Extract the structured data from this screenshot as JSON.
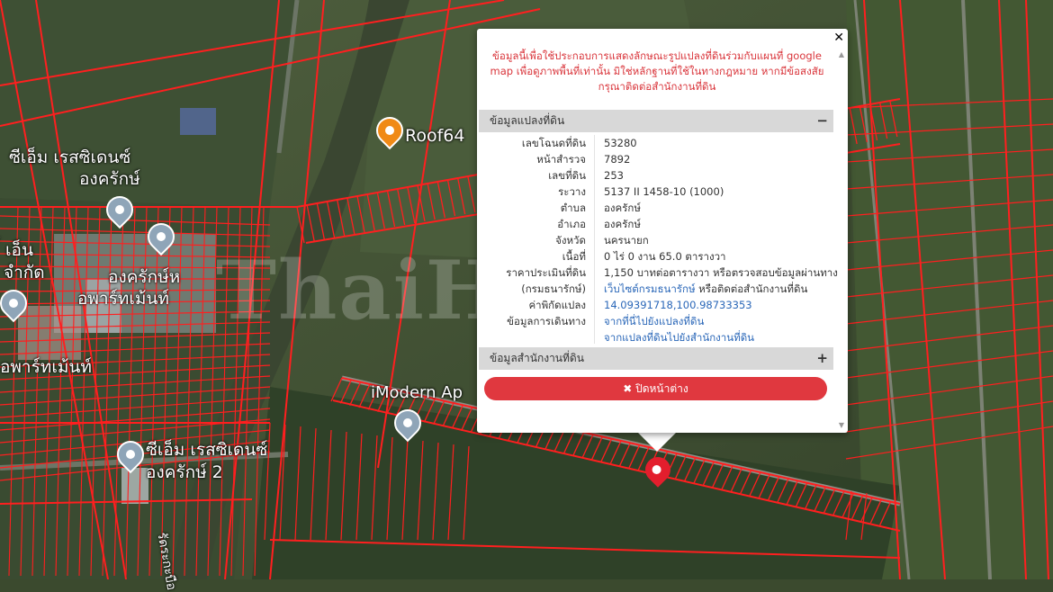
{
  "map": {
    "labels": {
      "cm_residence": "ซีเอ็ม เรสซิเดนซ์",
      "ongkharak": "องครักษ์",
      "ongkharak_apartment_1": "องครักษ์ห",
      "ongkharak_apartment_2": "อพาร์ทเม้นท์",
      "apartment_partial": "อพาร์ทเม้นท์",
      "en_partial": "์ เอ็น",
      "chamkat_partial": "จำกัด",
      "roof64": "Roof64",
      "imodern": "iModern Ap",
      "cm_residence_2_line1": "ซีเอ็ม เรสซิเดนซ์",
      "cm_residence_2_line2": "องครักษ์ 2",
      "road_partial": "รัดระกะบือ"
    },
    "watermark": "ThaiHome",
    "parcel_line_color": "#ff1f1f",
    "pin_selected_color": "#e31e2d",
    "pin_landmark_color": "#f08a16"
  },
  "popup": {
    "close_icon": "close-icon",
    "notice": "ข้อมูลนี้เพื่อใช้ประกอบการแสดงลักษณะรูปแปลงที่ดินร่วมกับแผนที่ google map เพื่อดูภาพพื้นที่เท่านั้น มิใช่หลักฐานที่ใช้ในทางกฎหมาย หากมีข้อสงสัย กรุณาติดต่อสำนักงานที่ดิน",
    "land_section": {
      "title": "ข้อมูลแปลงที่ดิน",
      "toggle": "−",
      "rows": [
        {
          "label": "เลขโฉนดที่ดิน",
          "value": "53280"
        },
        {
          "label": "หน้าสำรวจ",
          "value": "7892"
        },
        {
          "label": "เลขที่ดิน",
          "value": "253"
        },
        {
          "label": "ระวาง",
          "value": "5137 II 1458-10 (1000)"
        },
        {
          "label": "ตำบล",
          "value": "องครักษ์"
        },
        {
          "label": "อำเภอ",
          "value": "องครักษ์"
        },
        {
          "label": "จังหวัด",
          "value": "นครนายก"
        },
        {
          "label": "เนื้อที่",
          "value": "0 ไร่ 0 งาน 65.0 ตารางวา"
        },
        {
          "label": "ราคาประเมินที่ดิน",
          "value": "1,150 บาทต่อตารางวา หรือตรวจสอบข้อมูลผ่านทาง"
        },
        {
          "label": "(กรมธนารักษ์)",
          "value_link": "เว็บไซต์กรมธนารักษ์",
          "value_tail": " หรือติดต่อสำนักงานที่ดิน"
        },
        {
          "label": "ค่าพิกัดแปลง",
          "value": "14.09391718,100.98733353"
        },
        {
          "label": "ข้อมูลการเดินทาง",
          "value": "จากที่นี่ไปยังแปลงที่ดิน"
        },
        {
          "label": "",
          "value": "จากแปลงที่ดินไปยังสำนักงานที่ดิน"
        }
      ]
    },
    "office_section": {
      "title": "ข้อมูลสำนักงานที่ดิน",
      "toggle": "+"
    },
    "close_button": {
      "icon": "✖",
      "label": "ปิดหน้าต่าง"
    }
  }
}
